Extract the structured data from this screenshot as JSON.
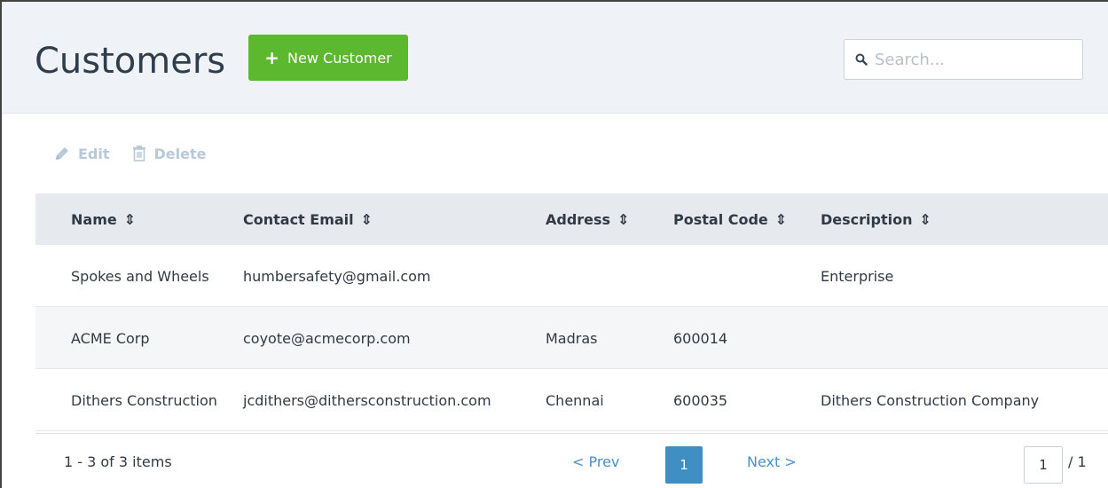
{
  "header": {
    "title": "Customers",
    "new_button_label": "New Customer",
    "search_placeholder": "Search..."
  },
  "toolbar": {
    "edit_label": "Edit",
    "delete_label": "Delete"
  },
  "table": {
    "columns": [
      "Name",
      "Contact Email",
      "Address",
      "Postal Code",
      "Description"
    ],
    "rows": [
      {
        "name": "Spokes and Wheels",
        "email": "humbersafety@gmail.com",
        "address": "",
        "postal": "",
        "description": "Enterprise"
      },
      {
        "name": "ACME Corp",
        "email": "coyote@acmecorp.com",
        "address": "Madras",
        "postal": "600014",
        "description": ""
      },
      {
        "name": "Dithers Construction",
        "email": "jcdithers@dithersconstruction.com",
        "address": "Chennai",
        "postal": "600035",
        "description": "Dithers Construction Company"
      }
    ]
  },
  "pagination": {
    "summary": "1 - 3 of 3 items",
    "prev_label": "< Prev",
    "current_page": "1",
    "next_label": "Next >",
    "page_input_value": "1",
    "page_total": "/ 1"
  },
  "colors": {
    "accent_green": "#5cb82e",
    "accent_blue": "#3f8fc5",
    "header_bg": "#eff2f6"
  }
}
